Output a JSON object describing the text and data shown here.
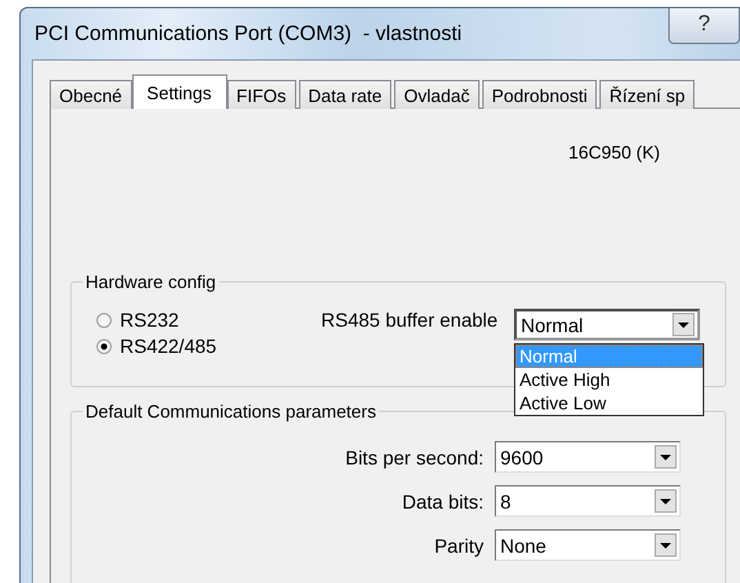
{
  "window": {
    "title": "PCI Communications Port (COM3)  - vlastnosti",
    "help_button": "?"
  },
  "tabs": [
    {
      "label": "Obecné",
      "selected": false
    },
    {
      "label": "Settings",
      "selected": true
    },
    {
      "label": "FIFOs",
      "selected": false
    },
    {
      "label": "Data rate",
      "selected": false
    },
    {
      "label": "Ovladač",
      "selected": false
    },
    {
      "label": "Podrobnosti",
      "selected": false
    },
    {
      "label": "Řízení sp",
      "selected": false
    }
  ],
  "device_name": "16C950 (K)",
  "hardware_config": {
    "title": "Hardware config",
    "modes": [
      {
        "label": "RS232",
        "selected": false
      },
      {
        "label": "RS422/485",
        "selected": true
      }
    ],
    "buffer_label": "RS485 buffer enable",
    "buffer_value": "Normal",
    "expanded": true,
    "buffer_options": [
      {
        "label": "Normal",
        "selected": true
      },
      {
        "label": "Active High",
        "selected": false
      },
      {
        "label": "Active Low",
        "selected": false
      }
    ]
  },
  "comm_params": {
    "title": "Default Communications parameters",
    "fields": [
      {
        "label": "Bits per second:",
        "value": "9600"
      },
      {
        "label": "Data bits:",
        "value": "8"
      },
      {
        "label": "Parity",
        "value": "None"
      }
    ]
  }
}
